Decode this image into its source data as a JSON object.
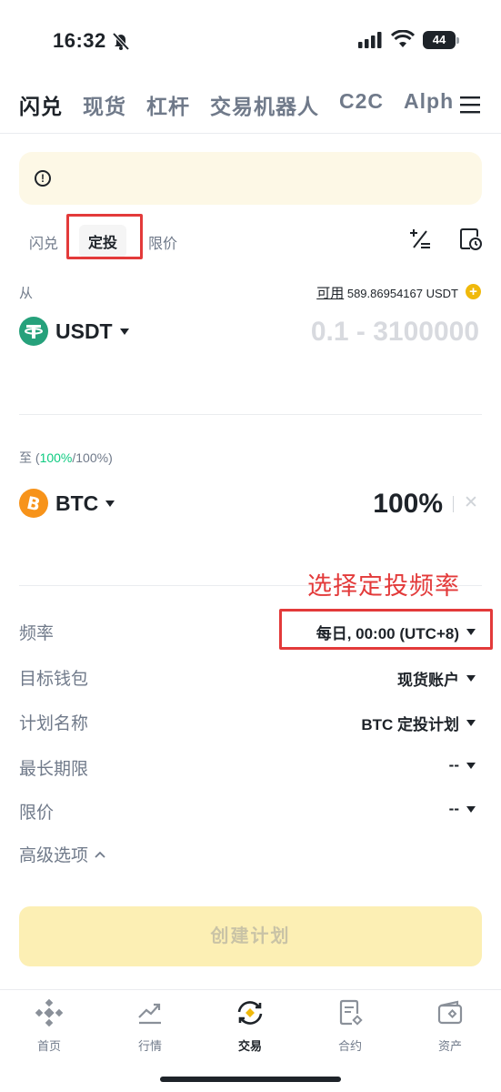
{
  "status_bar": {
    "time": "16:32",
    "battery": "44"
  },
  "top_nav": {
    "items": [
      "闪兑",
      "现货",
      "杠杆",
      "交易机器人",
      "C2C",
      "Alph"
    ],
    "active_index": 0
  },
  "sub_tabs": {
    "items": [
      "闪兑",
      "定投",
      "限价"
    ],
    "active_index": 1
  },
  "from": {
    "label": "从",
    "available_label": "可用",
    "available_value": "589.86954167 USDT",
    "coin": "USDT",
    "amount_placeholder": "0.1 - 3100000"
  },
  "to": {
    "label_prefix": "至 (",
    "pct_accent": "100%",
    "pct_rest": "/100%)",
    "coin": "BTC",
    "percentage": "100%"
  },
  "annotation": "选择定投频率",
  "settings": [
    {
      "label": "频率",
      "value": "每日, 00:00 (UTC+8)"
    },
    {
      "label": "目标钱包",
      "value": "现货账户"
    },
    {
      "label": "计划名称",
      "value": "BTC 定投计划"
    },
    {
      "label": "最长期限",
      "value": "--"
    },
    {
      "label": "限价",
      "value": "--"
    }
  ],
  "advanced_label": "高级选项",
  "create_button": "创建计划",
  "bottom_nav": [
    {
      "label": "首页",
      "icon": "home-icon"
    },
    {
      "label": "行情",
      "icon": "markets-icon"
    },
    {
      "label": "交易",
      "icon": "trade-icon"
    },
    {
      "label": "合约",
      "icon": "futures-icon"
    },
    {
      "label": "资产",
      "icon": "assets-icon"
    }
  ],
  "colors": {
    "accent": "#f0b90b",
    "annotation": "#e33a3a",
    "usdt": "#26a17b",
    "btc": "#f7931a",
    "green_text": "#0ecb81"
  }
}
